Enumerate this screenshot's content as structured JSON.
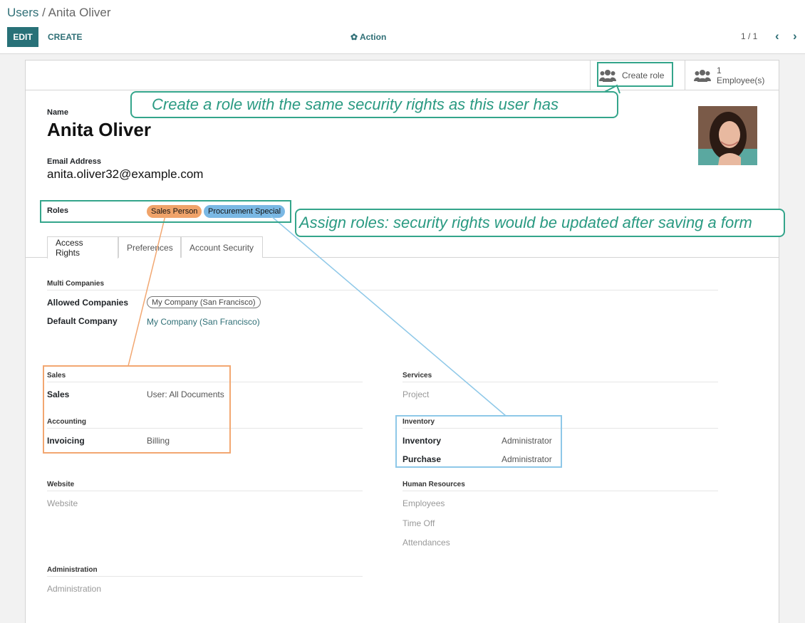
{
  "breadcrumb": {
    "parent": "Users",
    "separator": " / ",
    "current": "Anita Oliver"
  },
  "toolbar": {
    "edit": "EDIT",
    "create": "CREATE",
    "action": "Action",
    "pager": "1 / 1"
  },
  "smart_buttons": {
    "create_role": "Create role",
    "employees_count": "1",
    "employees_label": "Employee(s)"
  },
  "form": {
    "name_label": "Name",
    "name": "Anita Oliver",
    "email_label": "Email Address",
    "email": "anita.oliver32@example.com",
    "roles_label": "Roles",
    "roles": [
      "Sales Person",
      "Procurement Special"
    ]
  },
  "tabs": [
    "Access Rights",
    "Preferences",
    "Account Security"
  ],
  "access": {
    "multi_companies": "Multi Companies",
    "allowed_companies_label": "Allowed Companies",
    "allowed_companies": "My Company (San Francisco)",
    "default_company_label": "Default Company",
    "default_company": "My Company (San Francisco)",
    "sales_section": "Sales",
    "sales_label": "Sales",
    "sales_value": "User: All Documents",
    "accounting_section": "Accounting",
    "invoicing_label": "Invoicing",
    "invoicing_value": "Billing",
    "services_section": "Services",
    "project": "Project",
    "inventory_section": "Inventory",
    "inventory_label": "Inventory",
    "inventory_value": "Administrator",
    "purchase_label": "Purchase",
    "purchase_value": "Administrator",
    "website_section": "Website",
    "website": "Website",
    "hr_section": "Human Resources",
    "employees": "Employees",
    "time_off": "Time Off",
    "attendances": "Attendances",
    "admin_section": "Administration",
    "administration": "Administration"
  },
  "annotations": {
    "create_role_callout": "Create a role with the same security rights as this user has",
    "roles_callout": "Assign roles: security rights would be updated after saving a form"
  },
  "colors": {
    "accent": "#287178",
    "sales_tag": "#f0a36a",
    "procurement_tag": "#7ab8e4",
    "callout": "#34a58b"
  }
}
